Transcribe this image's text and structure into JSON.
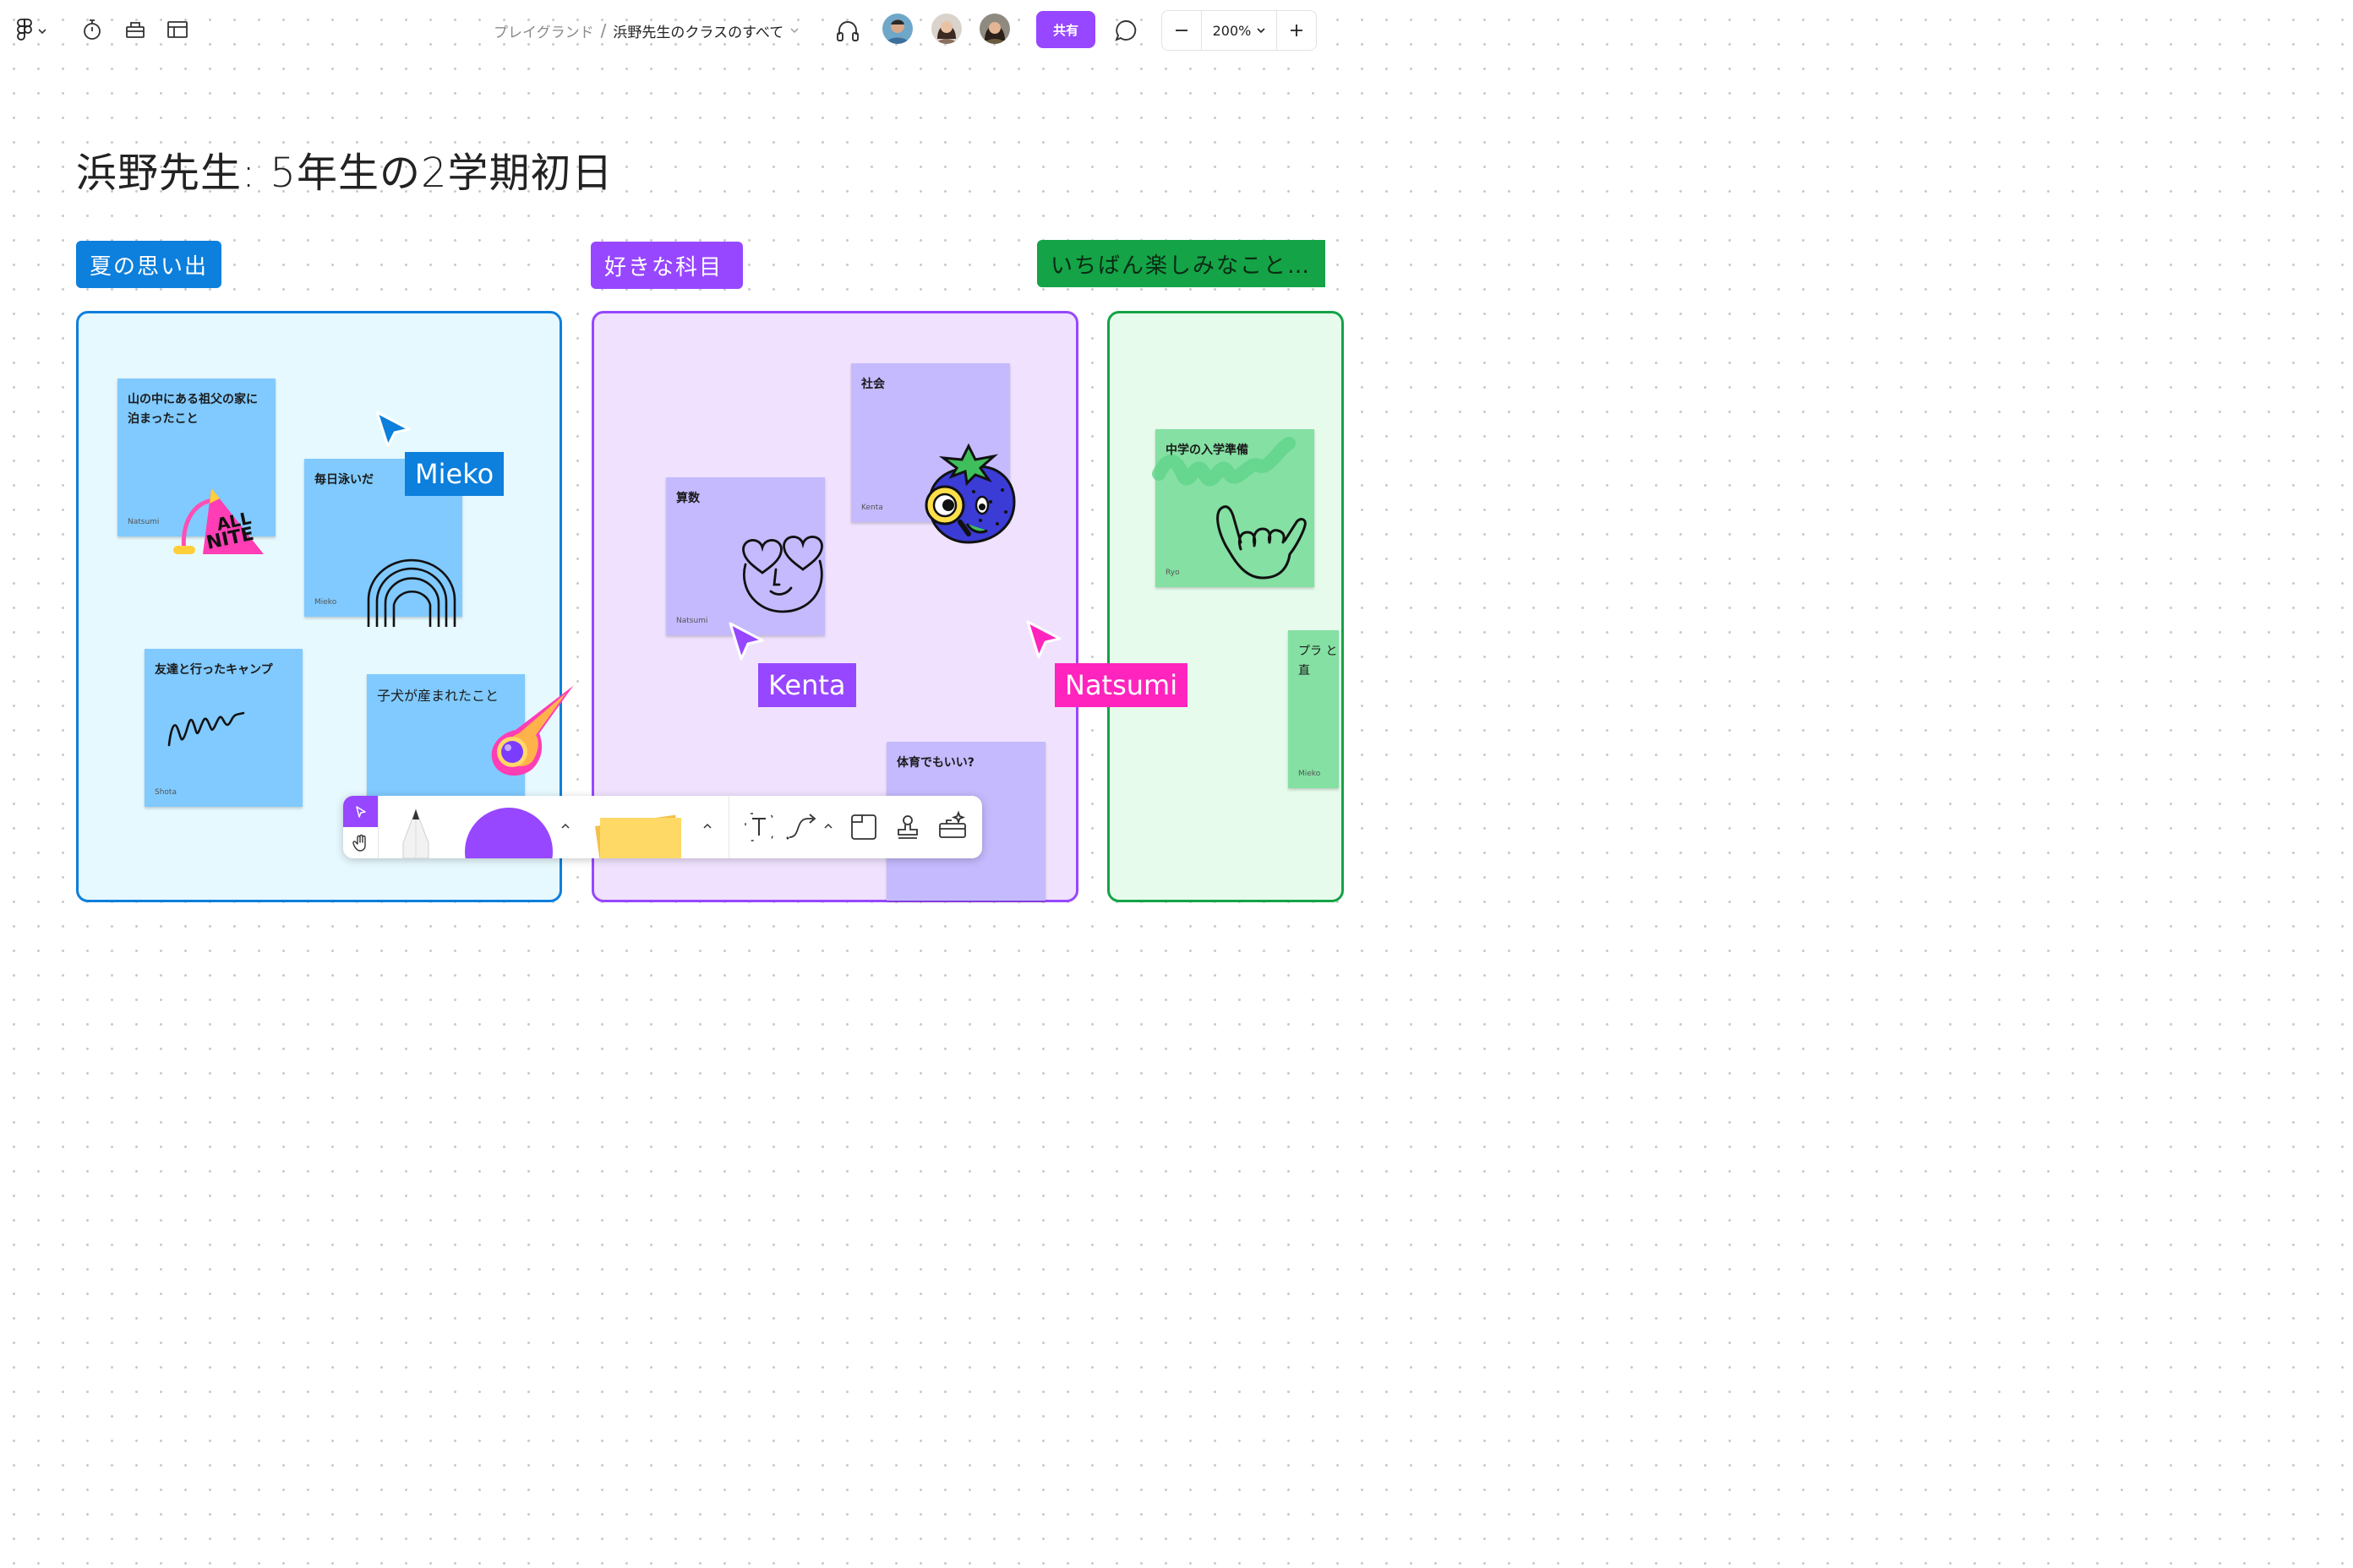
{
  "topbar": {
    "menu_icon": "figma-logo-icon",
    "breadcrumb_parent": "プレイグランド",
    "breadcrumb_separator": "/",
    "breadcrumb_current": "浜野先生のクラスのすべて",
    "share_label": "共有",
    "zoom_value": "200%"
  },
  "board": {
    "title": "浜野先生: 5年生の2学期初日",
    "sections": [
      {
        "label": "夏の思い出",
        "color": "#0d7fdc",
        "fill": "#e6f9fe",
        "stickies": [
          {
            "text": "山の中にある祖父の家に泊まったこと",
            "author": "Natsumi"
          },
          {
            "text": "毎日泳いだ",
            "author": "Mieko"
          },
          {
            "text": "友達と行ったキャンプ",
            "author": "Shota"
          },
          {
            "text": "子犬が産まれたこと",
            "author": ""
          }
        ]
      },
      {
        "label": "好きな科目",
        "color": "#9747ff",
        "fill": "#f0e2fe",
        "stickies": [
          {
            "text": "社会",
            "author": "Kenta"
          },
          {
            "text": "算数",
            "author": "Natsumi"
          },
          {
            "text": "体育でもいい?",
            "author": ""
          }
        ]
      },
      {
        "label": "いちばん楽しみなこと…",
        "color": "#14a346",
        "fill": "#e6fbec",
        "stickies": [
          {
            "text": "中学の入学準備",
            "author": "Ryo"
          },
          {
            "text": "プラ と直",
            "author": "Mieko"
          }
        ]
      }
    ]
  },
  "cursors": [
    {
      "name": "Mieko",
      "color": "#0d7fdc"
    },
    {
      "name": "Kenta",
      "color": "#9747ff"
    },
    {
      "name": "Natsumi",
      "color": "#ff24bd"
    }
  ],
  "colors": {
    "sticky_blue": "#80caff",
    "sticky_purple": "#c4bafd",
    "sticky_green": "#85e0a3",
    "sticky_yellow": "#ffd966",
    "accent": "#9747ff"
  }
}
